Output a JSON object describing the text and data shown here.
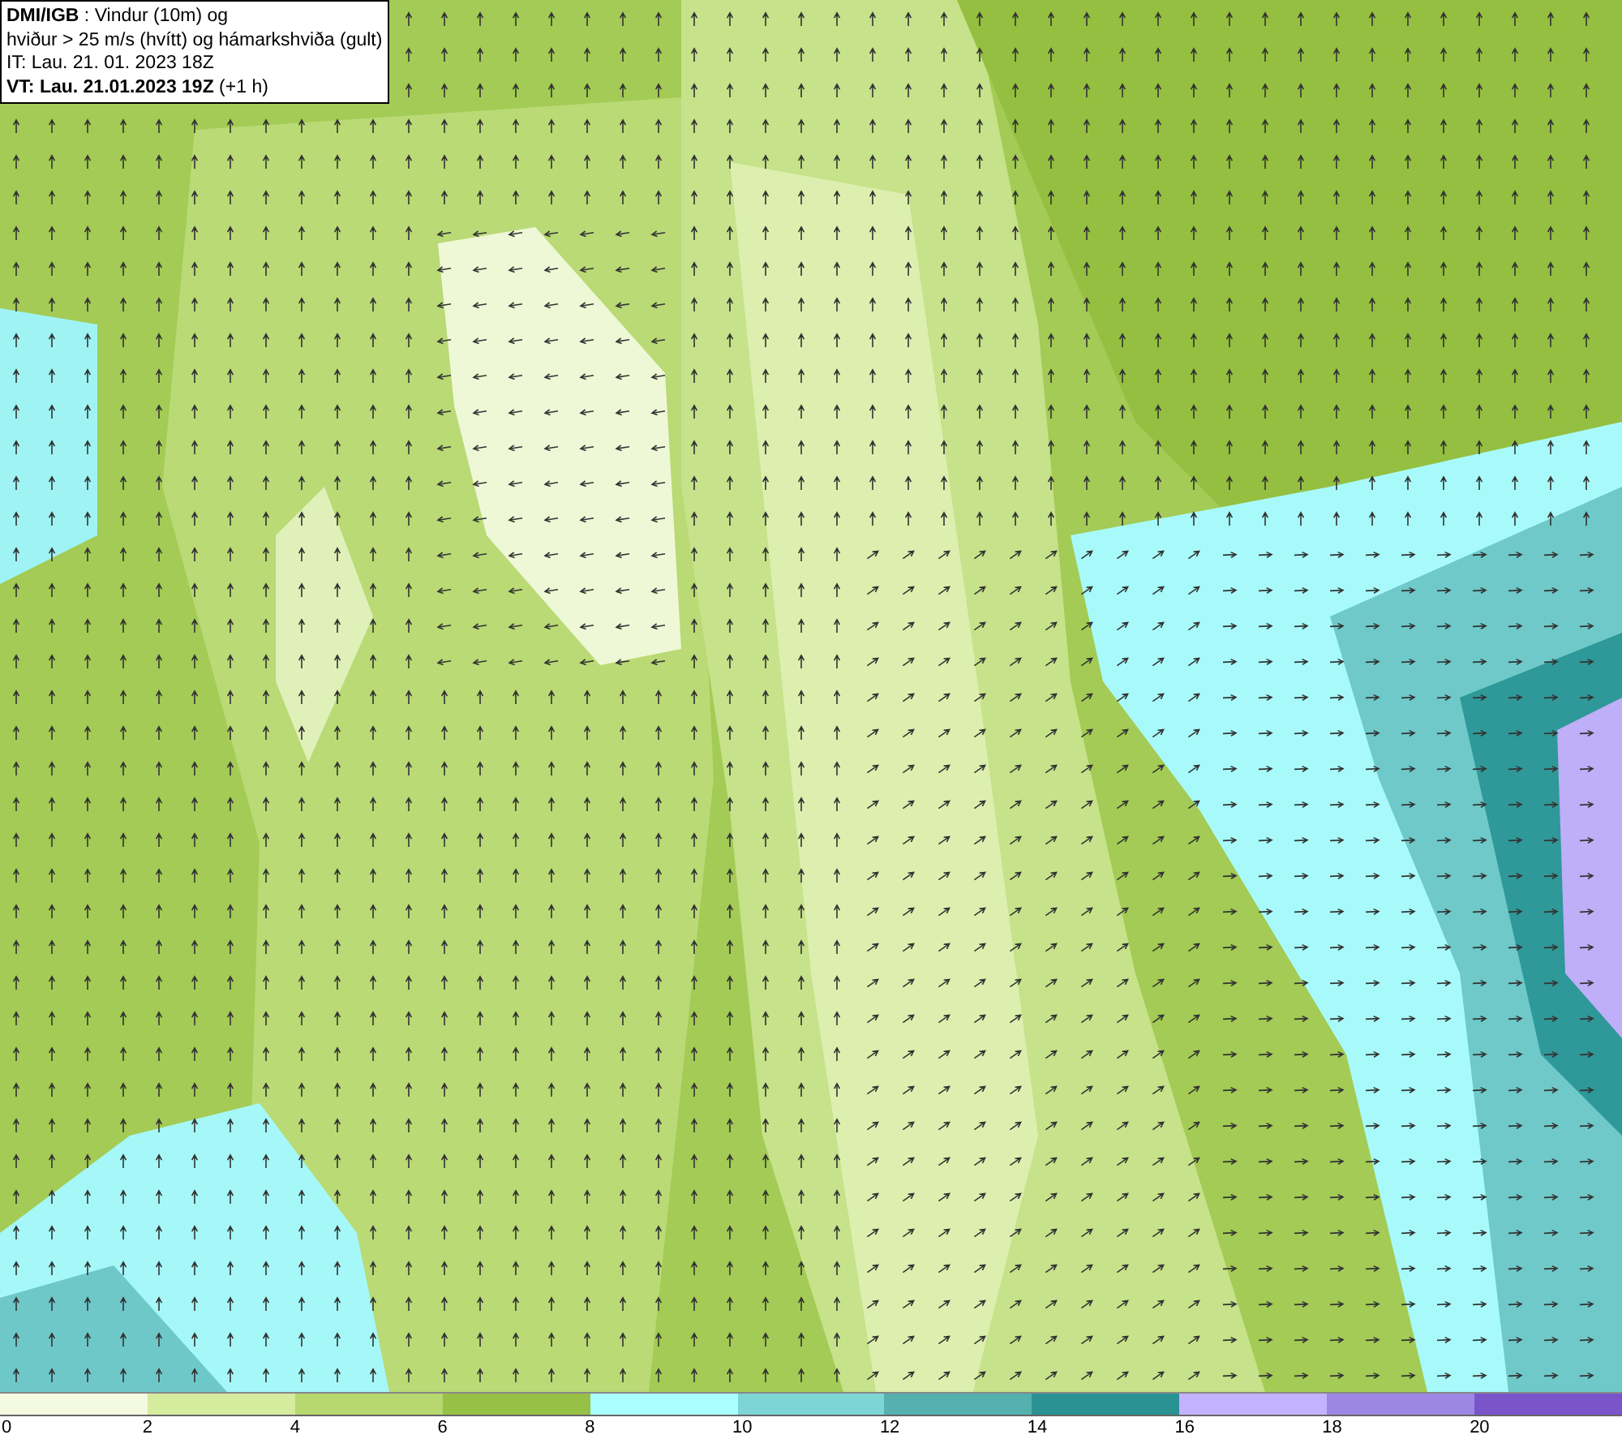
{
  "title_box": {
    "lines": [
      "**DMI/IGB** : Vindur (10m) og",
      "hviður > 25 m/s (hvítt) og hámarkshviða (gult)",
      "IT: Lau. 21. 01. 2023 18Z",
      "**VT: Lau. 21.01.2023 19Z** (+1 h)"
    ]
  },
  "legend": [
    {
      "label": "0",
      "color": "#f4fae0"
    },
    {
      "label": "2",
      "color": "#d5eb9e"
    },
    {
      "label": "4",
      "color": "#b6d86e"
    },
    {
      "label": "6",
      "color": "#97c046"
    },
    {
      "label": "8",
      "color": "#aaffff"
    },
    {
      "label": "10",
      "color": "#7ed5d5"
    },
    {
      "label": "12",
      "color": "#55b0b0"
    },
    {
      "label": "14",
      "color": "#2a9292"
    },
    {
      "label": "16",
      "color": "#c3b3ff"
    },
    {
      "label": "18",
      "color": "#9e86e4"
    },
    {
      "label": "20",
      "color": "#7a55c9"
    }
  ]
}
